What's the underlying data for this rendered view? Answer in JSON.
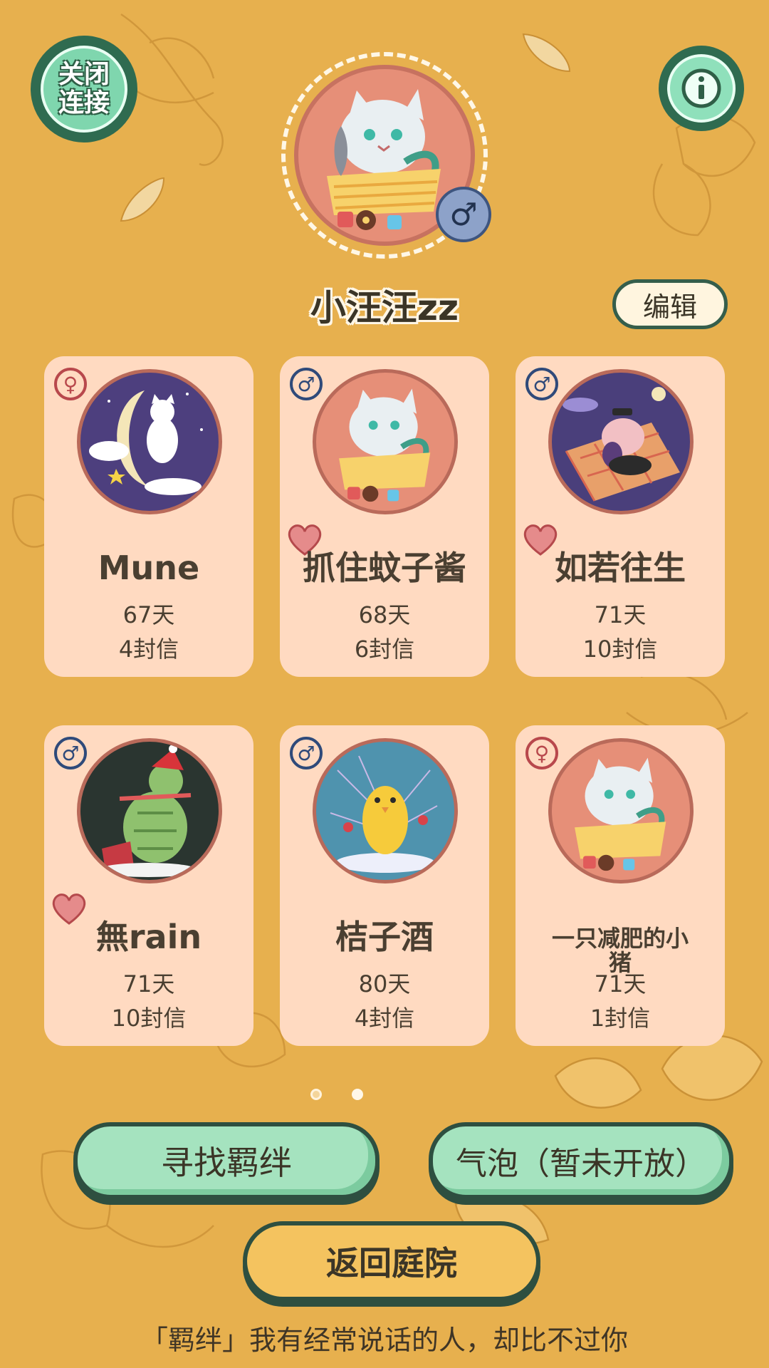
{
  "top": {
    "close_connection_label": "关闭连接",
    "info_icon": "info-icon"
  },
  "profile": {
    "username": "小汪汪zz",
    "gender_symbol": "♂",
    "edit_label": "编辑"
  },
  "contacts": [
    {
      "name": "Mune",
      "days": "67天",
      "letters": "4封信",
      "gender": "♀",
      "hearted": false
    },
    {
      "name": "抓住蚊子酱",
      "days": "68天",
      "letters": "6封信",
      "gender": "♂",
      "hearted": true
    },
    {
      "name": "如若往生",
      "days": "71天",
      "letters": "10封信",
      "gender": "♂",
      "hearted": true
    },
    {
      "name": "無rain",
      "days": "71天",
      "letters": "10封信",
      "gender": "♂",
      "hearted": true
    },
    {
      "name": "桔子酒",
      "days": "80天",
      "letters": "4封信",
      "gender": "♂",
      "hearted": false
    },
    {
      "name": "一只减肥的小猪",
      "days": "71天",
      "letters": "1封信",
      "gender": "♀",
      "hearted": false
    }
  ],
  "pagination": {
    "total": 2,
    "current": 2
  },
  "actions": {
    "find_bond_label": "寻找羁绊",
    "bubble_label": "气泡（暂未开放）",
    "return_label": "返回庭院"
  },
  "footer": {
    "quote": "「羁绊」我有经常说话的人，却比不过你"
  },
  "colors": {
    "background": "#E7B04E",
    "card": "#FFDAC1",
    "button_green": "#A5E3BF",
    "button_yellow": "#F4C35F",
    "outline": "#2E4F40"
  }
}
